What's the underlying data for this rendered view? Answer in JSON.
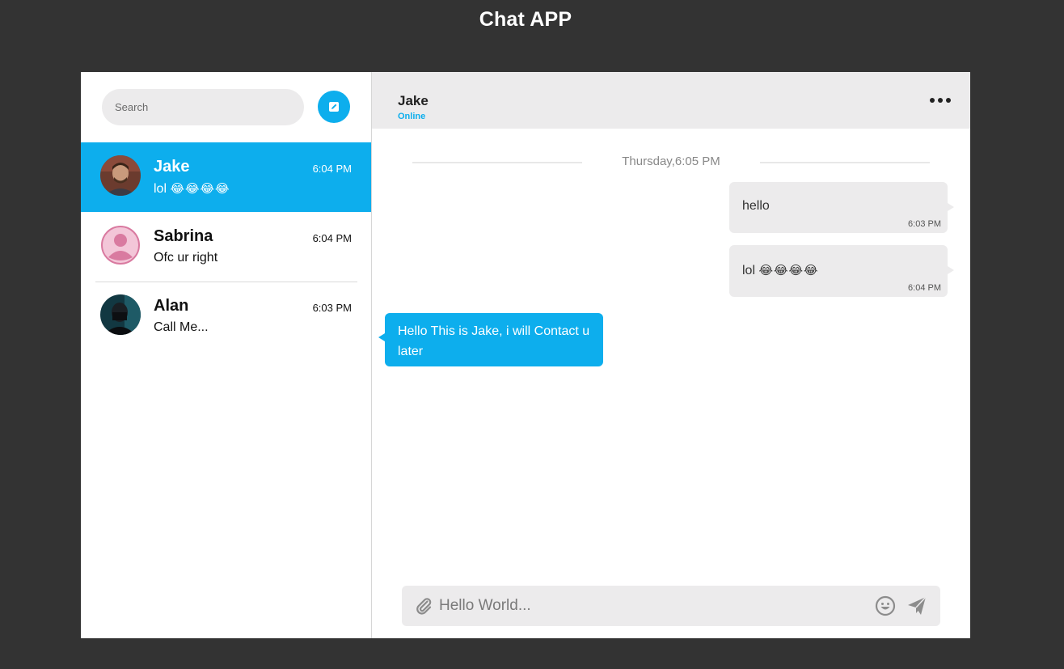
{
  "app": {
    "title": "Chat APP"
  },
  "colors": {
    "accent": "#0daeed",
    "background": "#333333",
    "panel": "#ecebec"
  },
  "sidebar": {
    "search": {
      "placeholder": "Search",
      "value": ""
    },
    "compose_icon": "edit-icon",
    "contacts": [
      {
        "name": "Jake",
        "time": "6:04 PM",
        "preview": "lol",
        "preview_emoji": "😂😂😂😂",
        "active": true,
        "avatar": "photo"
      },
      {
        "name": "Sabrina",
        "time": "6:04 PM",
        "preview": "Ofc ur right",
        "preview_emoji": "",
        "active": false,
        "avatar": "placeholder"
      },
      {
        "name": "Alan",
        "time": "6:03 PM",
        "preview": "Call Me...",
        "preview_emoji": "",
        "active": false,
        "avatar": "photo"
      }
    ]
  },
  "chat": {
    "header": {
      "name": "Jake",
      "status": "Online",
      "menu_icon": "more-icon"
    },
    "date_separator": "Thursday,6:05 PM",
    "messages": [
      {
        "direction": "out",
        "text": "hello",
        "emoji": "",
        "time": "6:03 PM"
      },
      {
        "direction": "out",
        "text": "lol",
        "emoji": "😂😂😂😂",
        "time": "6:04 PM"
      },
      {
        "direction": "in",
        "text": "Hello This is Jake, i will Contact u later",
        "emoji": "",
        "time": ""
      }
    ],
    "composer": {
      "placeholder": "Hello World...",
      "value": "",
      "attach_icon": "paperclip-icon",
      "emoji_icon": "smiley-icon",
      "send_icon": "send-icon"
    }
  }
}
